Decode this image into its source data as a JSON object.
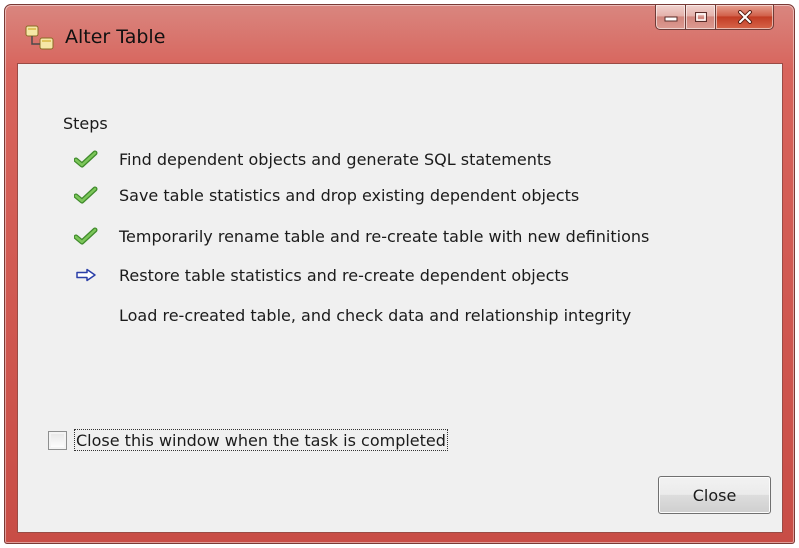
{
  "window": {
    "title": "Alter Table",
    "controls": {
      "minimize": "minimize",
      "maximize": "maximize",
      "close": "close"
    },
    "frame_color": "#d8645c"
  },
  "steps": {
    "heading": "Steps",
    "items": [
      {
        "status": "done",
        "icon": "check-icon",
        "label": "Find dependent objects and generate SQL statements"
      },
      {
        "status": "done",
        "icon": "check-icon",
        "label": "Save table statistics and drop existing dependent objects"
      },
      {
        "status": "done",
        "icon": "check-icon",
        "label": "Temporarily rename table and re-create table with new definitions"
      },
      {
        "status": "current",
        "icon": "arrow-right-icon",
        "label": "Restore table statistics and re-create dependent objects"
      },
      {
        "status": "pending",
        "icon": "",
        "label": "Load re-created table, and check data and relationship integrity"
      }
    ]
  },
  "options": {
    "close_when_done_label": "Close this window when the task is completed",
    "close_when_done_checked": false
  },
  "footer": {
    "close_label": "Close"
  }
}
